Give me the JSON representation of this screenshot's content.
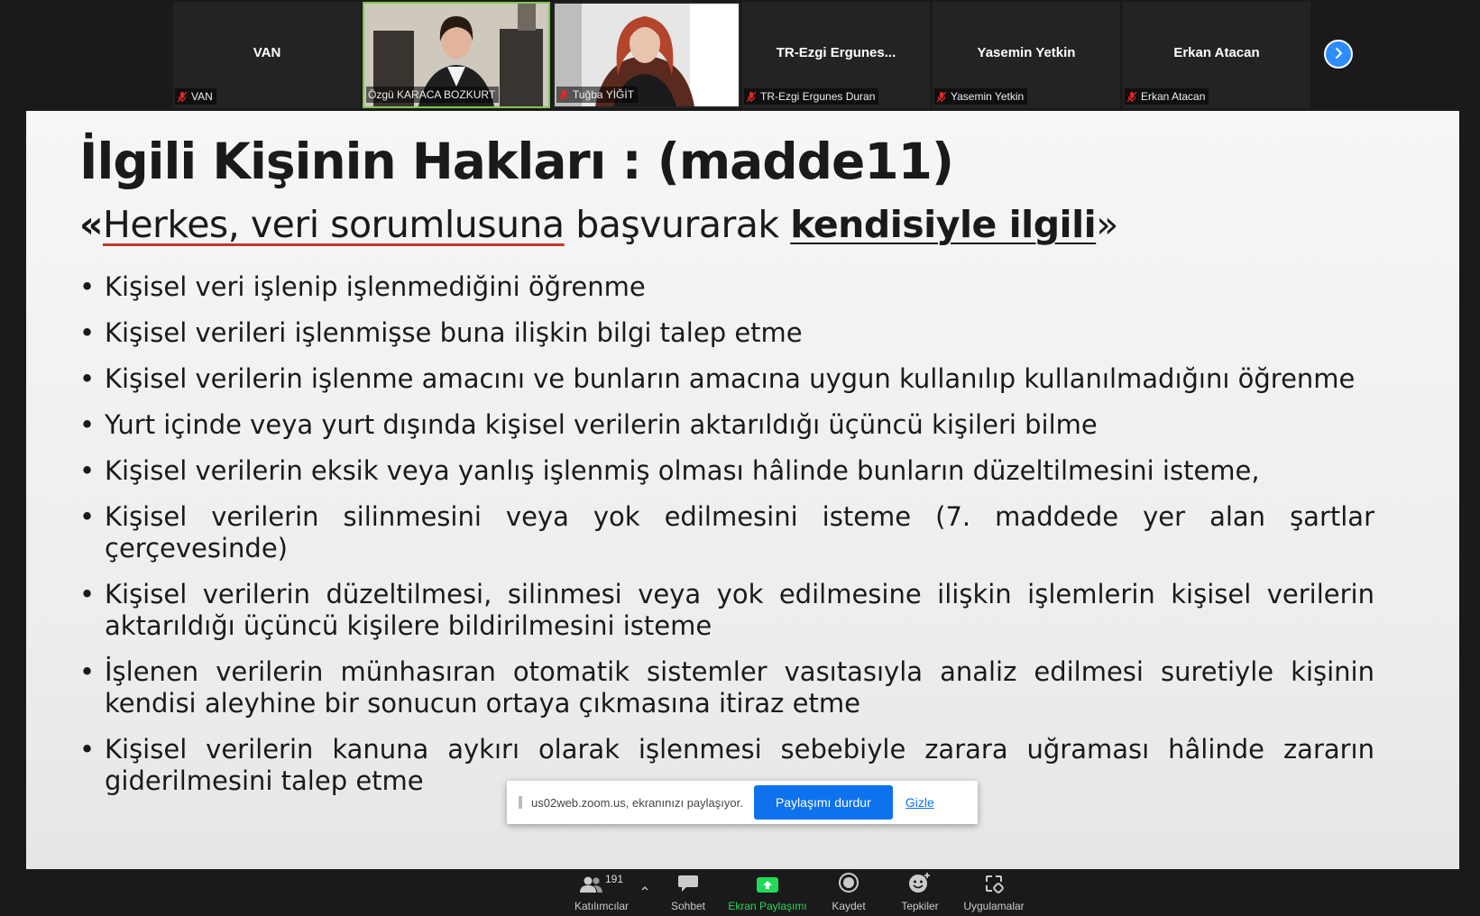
{
  "participants": [
    {
      "big_name": "VAN",
      "label": "VAN",
      "muted": true,
      "video": false
    },
    {
      "big_name": "",
      "label": "Özgü KARACA BOZKURT",
      "muted": false,
      "video": true
    },
    {
      "big_name": "",
      "label": "Tuğba YİĞİT",
      "muted": true,
      "video": true
    },
    {
      "big_name": "TR-Ezgi  Ergunes...",
      "label": "TR-Ezgi Ergunes Duran",
      "muted": true,
      "video": false
    },
    {
      "big_name": "Yasemin Yetkin",
      "label": "Yasemin Yetkin",
      "muted": true,
      "video": false
    },
    {
      "big_name": "Erkan Atacan",
      "label": "Erkan Atacan",
      "muted": true,
      "video": false
    }
  ],
  "slide": {
    "title": "İlgili Kişinin Hakları : (madde11)",
    "subtitle_open": "«",
    "subtitle_underlined": "Herkes, veri sorumlusuna",
    "subtitle_middle": " başvurarak ",
    "subtitle_bold": "kendisiyle ilgili",
    "subtitle_close": "»",
    "bullet_char": "•",
    "bullets": [
      "Kişisel veri işlenip işlenmediğini öğrenme",
      "Kişisel verileri işlenmişse buna ilişkin bilgi talep etme",
      "Kişisel verilerin işlenme amacını ve bunların amacına uygun kullanılıp kullanılmadığını öğrenme",
      "Yurt içinde veya yurt dışında kişisel verilerin aktarıldığı üçüncü kişileri bilme",
      "Kişisel verilerin eksik veya yanlış işlenmiş olması hâlinde bunların düzeltilmesini isteme,",
      "Kişisel verilerin silinmesini veya yok edilmesini isteme (7. maddede yer alan şartlar çerçevesinde)",
      "Kişisel verilerin düzeltilmesi, silinmesi veya yok edilmesine ilişkin işlemlerin kişisel verilerin aktarıldığı üçüncü kişilere bildirilmesini isteme",
      "İşlenen verilerin münhasıran otomatik sistemler vasıtasıyla analiz edilmesi suretiyle kişinin kendisi aleyhine bir sonucun ortaya çıkmasına itiraz etme",
      "Kişisel verilerin kanuna aykırı olarak işlenmesi sebebiyle zarara uğraması hâlinde zararın giderilmesini talep etme"
    ]
  },
  "share_bar": {
    "message": "us02web.zoom.us, ekranınızı paylaşıyor.",
    "stop_label": "Paylaşımı durdur",
    "hide_label": "Gizle"
  },
  "toolbar": {
    "participants_count": "191",
    "participants_label": "Katılımcılar",
    "chat_label": "Sohbet",
    "share_label": "Ekran Paylaşımı",
    "record_label": "Kaydet",
    "reactions_label": "Tepkiler",
    "apps_label": "Uygulamalar"
  },
  "colors": {
    "accent_blue": "#0e72ed",
    "share_green": "#23d959",
    "active_speaker": "#7ec850",
    "mic_off_red": "#e02828"
  }
}
